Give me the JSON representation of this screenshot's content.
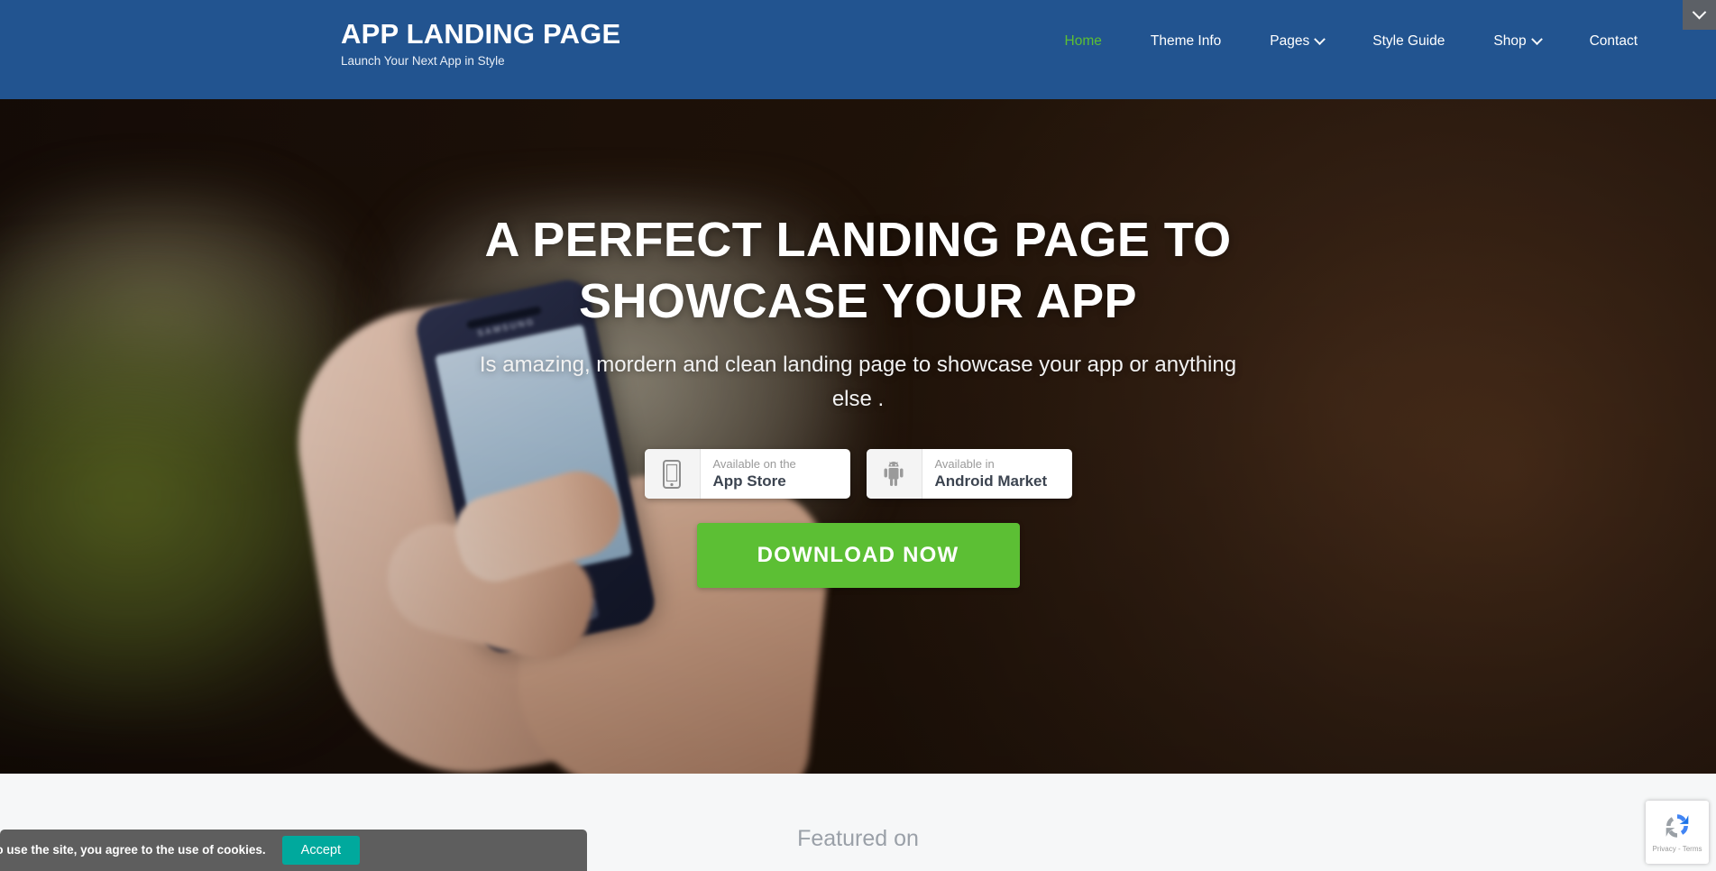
{
  "header": {
    "brand_title": "APP LANDING PAGE",
    "brand_tagline": "Launch Your Next App in Style",
    "background_color": "#225490",
    "nav": [
      {
        "label": "Home",
        "active": true,
        "has_caret": false
      },
      {
        "label": "Theme Info",
        "active": false,
        "has_caret": false
      },
      {
        "label": "Pages",
        "active": false,
        "has_caret": true
      },
      {
        "label": "Style Guide",
        "active": false,
        "has_caret": false
      },
      {
        "label": "Shop",
        "active": false,
        "has_caret": true
      },
      {
        "label": "Contact",
        "active": false,
        "has_caret": false
      }
    ],
    "active_color": "#5cbf34"
  },
  "collapse_widget": {
    "icon": "chevron-down-icon",
    "background_color": "#5c6066"
  },
  "hero": {
    "title": "A PERFECT LANDING PAGE TO SHOWCASE YOUR APP",
    "subtitle": "Is amazing, mordern and clean landing page to showcase your app or anything else .",
    "badges": [
      {
        "icon": "iphone-icon",
        "top_label": "Available on the",
        "bottom_label": "App Store"
      },
      {
        "icon": "android-robot-icon",
        "top_label": "Available in",
        "bottom_label": "Android Market"
      }
    ],
    "download_label": "DOWNLOAD NOW",
    "download_color": "#5cbf34",
    "phone_brand_on_device": "SAMSUNG"
  },
  "featured": {
    "title": "Featured on",
    "background_color": "#f6f7f8"
  },
  "cookie_bar": {
    "message": "By continuing to use the site, you agree to the use of cookies.",
    "accept_label": "Accept",
    "background_color": "#5e5e5e",
    "accept_color": "#00a99d"
  },
  "recaptcha": {
    "terms_label": "Privacy - Terms",
    "icon": "recaptcha-logo-icon"
  }
}
